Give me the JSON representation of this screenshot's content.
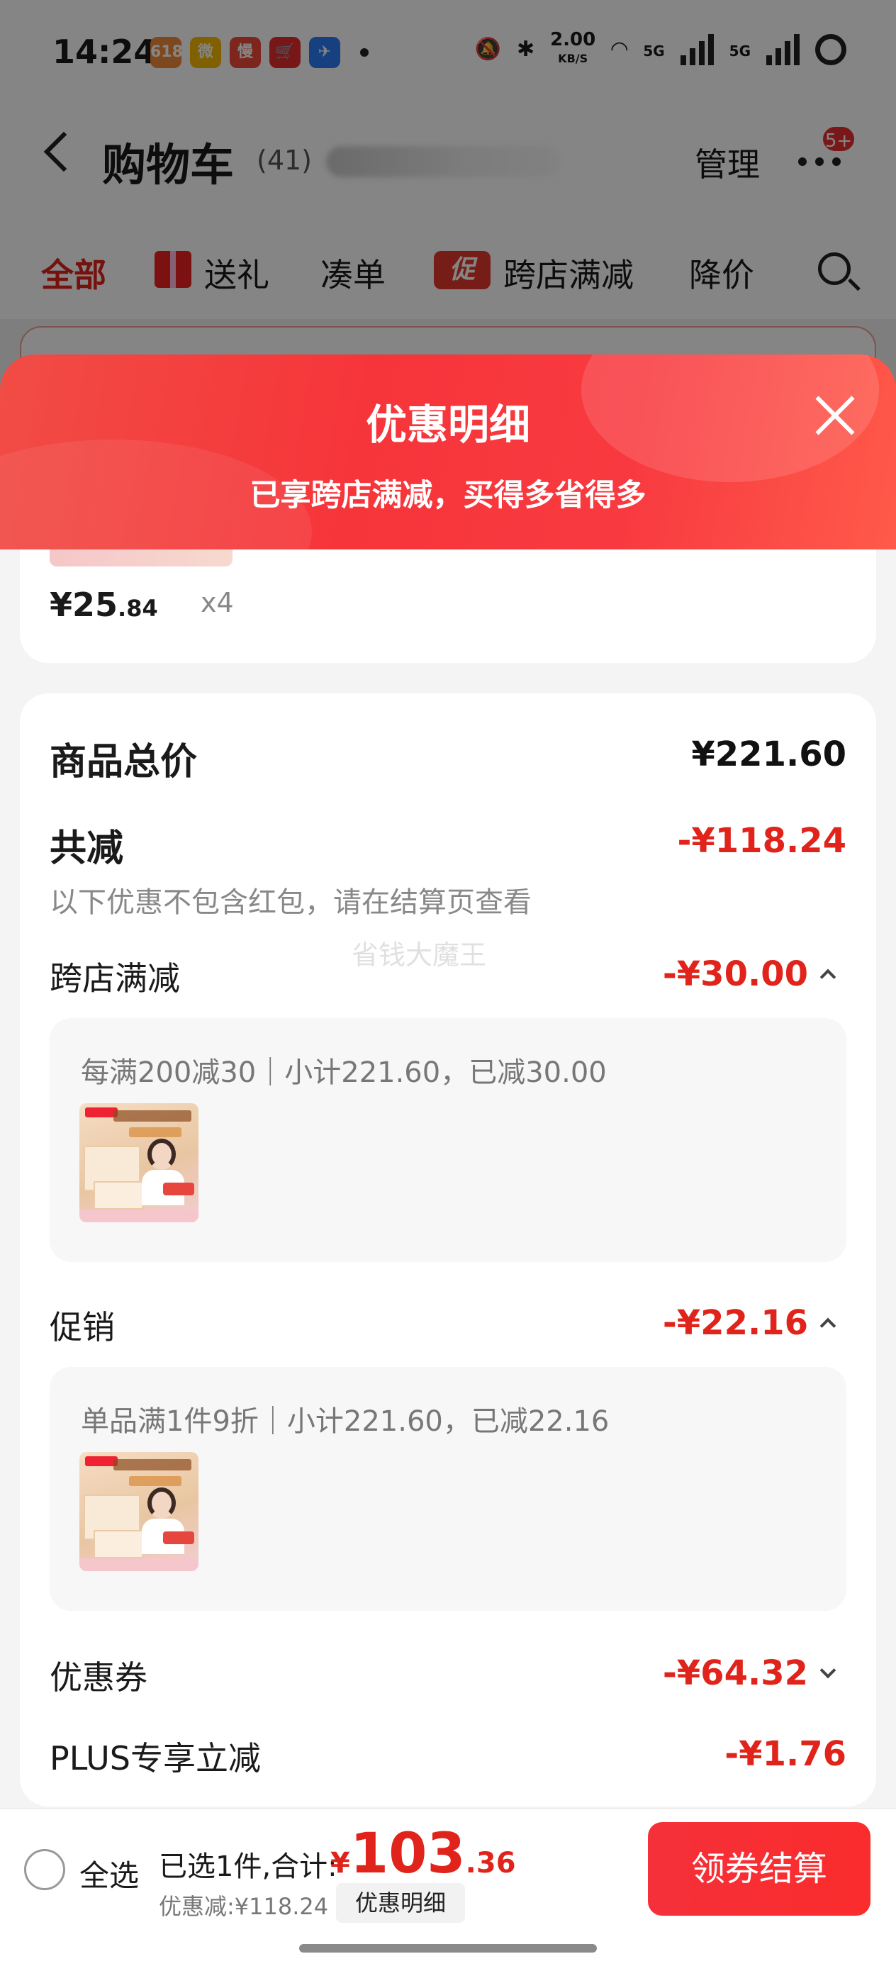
{
  "status_bar": {
    "time": "14:24",
    "apps": [
      {
        "name": "taobao-app-icon",
        "glyph": "618",
        "color": "#f08a3a"
      },
      {
        "name": "weibo-app-icon",
        "glyph": "微",
        "color": "#f5b800"
      },
      {
        "name": "manman-app-icon",
        "glyph": "慢",
        "color": "#ef4a3a"
      },
      {
        "name": "jd-cart-app-icon",
        "glyph": "🛒",
        "color": "#e52d2d"
      },
      {
        "name": "feishu-app-icon",
        "glyph": "✈",
        "color": "#2d7cf6"
      }
    ],
    "net_speed": "2.00",
    "net_unit": "KB/S",
    "network_a": "5G",
    "network_b": "5G"
  },
  "header": {
    "title": "购物车",
    "count": "(41)",
    "manage": "管理",
    "badge": "5+"
  },
  "tabs": {
    "all": "全部",
    "gift": "送礼",
    "bundle": "凑单",
    "promo_icon": "促",
    "cross_store": "跨店满减",
    "price_drop": "降价"
  },
  "sheet": {
    "title": "优惠明细",
    "subtitle": "已享跨店满减，买得多省得多"
  },
  "item": {
    "price_int": "¥25",
    "price_dec": ".84",
    "qty": "x4"
  },
  "summary": {
    "total_label": "商品总价",
    "total_value": "¥221.60",
    "reduce_label": "共减",
    "reduce_value": "-¥118.24",
    "note": "以下优惠不包含红包，请在结算页查看",
    "watermark": "省钱大魔王"
  },
  "discounts": {
    "cross_store": {
      "label": "跨店满减",
      "value": "-¥30.00",
      "detail": "每满200减30｜小计221.60，已减30.00"
    },
    "promotion": {
      "label": "促销",
      "value": "-¥22.16",
      "detail": "单品满1件9折｜小计221.60，已减22.16"
    },
    "coupon": {
      "label": "优惠券",
      "value": "-¥64.32"
    },
    "plus": {
      "label": "PLUS专享立减",
      "value": "-¥1.76"
    }
  },
  "bottom_bar": {
    "select_all": "全选",
    "selected_text": "已选1件,合计:",
    "total_yen": "¥",
    "total_int": "103",
    "total_dec": ".36",
    "discount_text": "优惠减:¥118.24",
    "detail_chip": "优惠明细",
    "checkout": "领券结算"
  }
}
